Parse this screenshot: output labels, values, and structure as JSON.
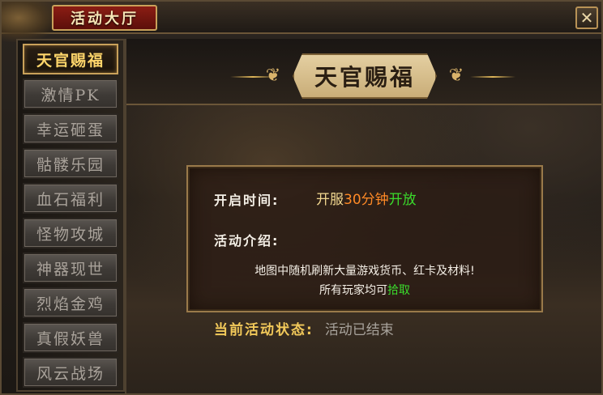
{
  "window": {
    "title": "活动大厅",
    "close_glyph": "✕"
  },
  "menu": {
    "items": [
      {
        "label": "天官赐福",
        "active": true
      },
      {
        "label": "激情PK",
        "active": false
      },
      {
        "label": "幸运砸蛋",
        "active": false
      },
      {
        "label": "骷髅乐园",
        "active": false
      },
      {
        "label": "血石福利",
        "active": false
      },
      {
        "label": "怪物攻城",
        "active": false
      },
      {
        "label": "神器现世",
        "active": false
      },
      {
        "label": "烈焰金鸡",
        "active": false
      },
      {
        "label": "真假妖兽",
        "active": false
      },
      {
        "label": "风云战场",
        "active": false
      }
    ]
  },
  "panel": {
    "banner_title": "天官赐福",
    "open_time_label": "开启时间:",
    "open_time_value": {
      "prefix": "开服",
      "highlight": "30分钟",
      "suffix": "开放"
    },
    "intro_label": "活动介绍:",
    "intro_lines": {
      "line1": "地图中随机刷新大量游戏货币、红卡及材料!",
      "line2_prefix": "所有玩家均可",
      "line2_highlight": "拾取"
    },
    "status_label": "当前活动状态:",
    "status_value": "活动已结束"
  },
  "colors": {
    "accent_gold": "#c9a15a",
    "active_menu_text": "#ffd66b",
    "highlight_orange": "#ff8a26",
    "highlight_green": "#3bdc2c",
    "status_label": "#f2c95a",
    "status_value": "#a8a39c"
  },
  "icons": {
    "close": "close-icon",
    "banner_ornament": "swirl-ornament-icon"
  }
}
